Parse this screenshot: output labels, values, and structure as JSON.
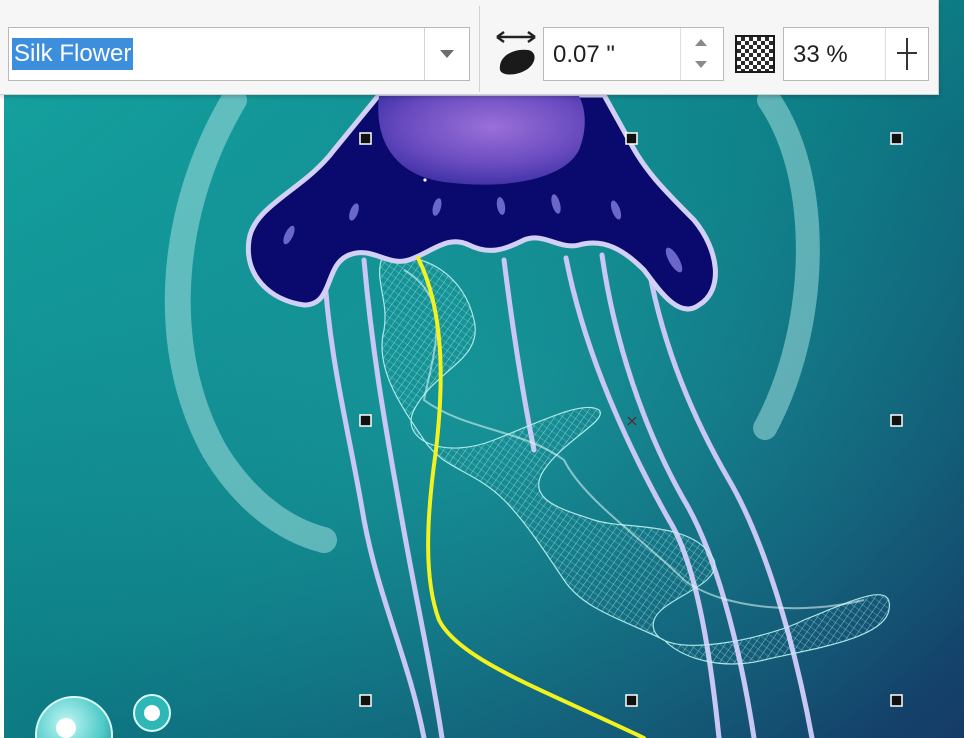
{
  "property_bar": {
    "preset_name": "Silk Flower",
    "brush_width": "0.07 \"",
    "opacity": "33 %"
  },
  "icons": {
    "preset_dropdown": "chevron-down-icon",
    "width": "brush-width-icon",
    "spin_up": "arrow-up-icon",
    "spin_down": "arrow-down-icon",
    "transparency": "transparency-checkerboard-icon",
    "opacity_slider": "slider-icon"
  },
  "colors": {
    "selection_highlight": "#3e8ede",
    "path_stroke": "#f2f21e",
    "jellyfish_bell": "#0a0a6e",
    "tentacle": "#c7c5f2",
    "silk_strokes": "#9ce6e6",
    "background_top": "#149e9e",
    "background_bottom": "#0f4f73"
  }
}
